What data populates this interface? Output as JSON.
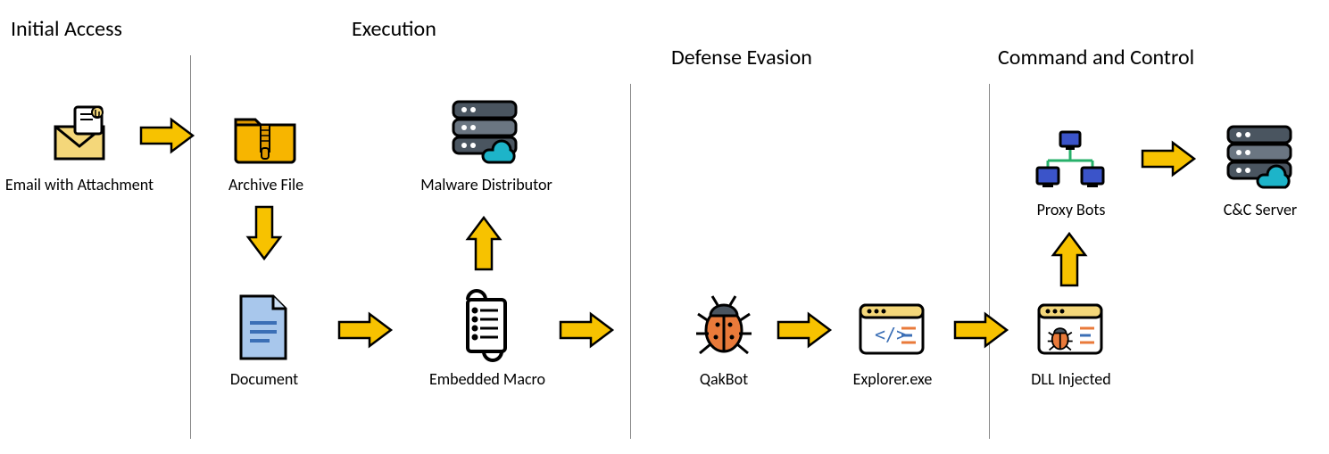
{
  "phases": {
    "initial_access": "Initial Access",
    "execution": "Execution",
    "defense_evasion": "Defense Evasion",
    "command_and_control": "Command and Control"
  },
  "nodes": {
    "email": "Email with Attachment",
    "archive": "Archive File",
    "document": "Document",
    "malware_distributor": "Malware Distributor",
    "embedded_macro": "Embedded Macro",
    "qakbot": "QakBot",
    "explorer": "Explorer.exe",
    "dll_injected": "DLL Injected",
    "proxy_bots": "Proxy Bots",
    "cc_server": "C&C Server"
  },
  "icons": {
    "email": "envelope-attachment-icon",
    "archive": "zip-folder-icon",
    "document": "document-icon",
    "server": "cloud-server-icon",
    "script": "script-scroll-icon",
    "bug": "bug-icon",
    "code_window": "code-window-icon",
    "injected_window": "injected-window-icon",
    "network": "network-bots-icon"
  },
  "colors": {
    "arrow": "#f7c200",
    "arrow_stroke": "#000000",
    "folder": "#f7b500",
    "folder_shadow": "#e09900",
    "doc_blue": "#a8c7ec",
    "doc_line": "#3b6fb6",
    "server_dark": "#4a5560",
    "server_light": "#6b7682",
    "cloud": "#1db4c9",
    "bug_body": "#e97a3a",
    "window_blue": "#3b6fb6",
    "window_orange": "#e97a3a",
    "net_blue": "#3b54c9"
  },
  "flow": [
    [
      "email",
      "archive"
    ],
    [
      "archive",
      "document"
    ],
    [
      "document",
      "embedded_macro"
    ],
    [
      "embedded_macro",
      "malware_distributor"
    ],
    [
      "embedded_macro",
      "qakbot"
    ],
    [
      "qakbot",
      "explorer"
    ],
    [
      "explorer",
      "dll_injected"
    ],
    [
      "dll_injected",
      "proxy_bots"
    ],
    [
      "proxy_bots",
      "cc_server"
    ]
  ]
}
